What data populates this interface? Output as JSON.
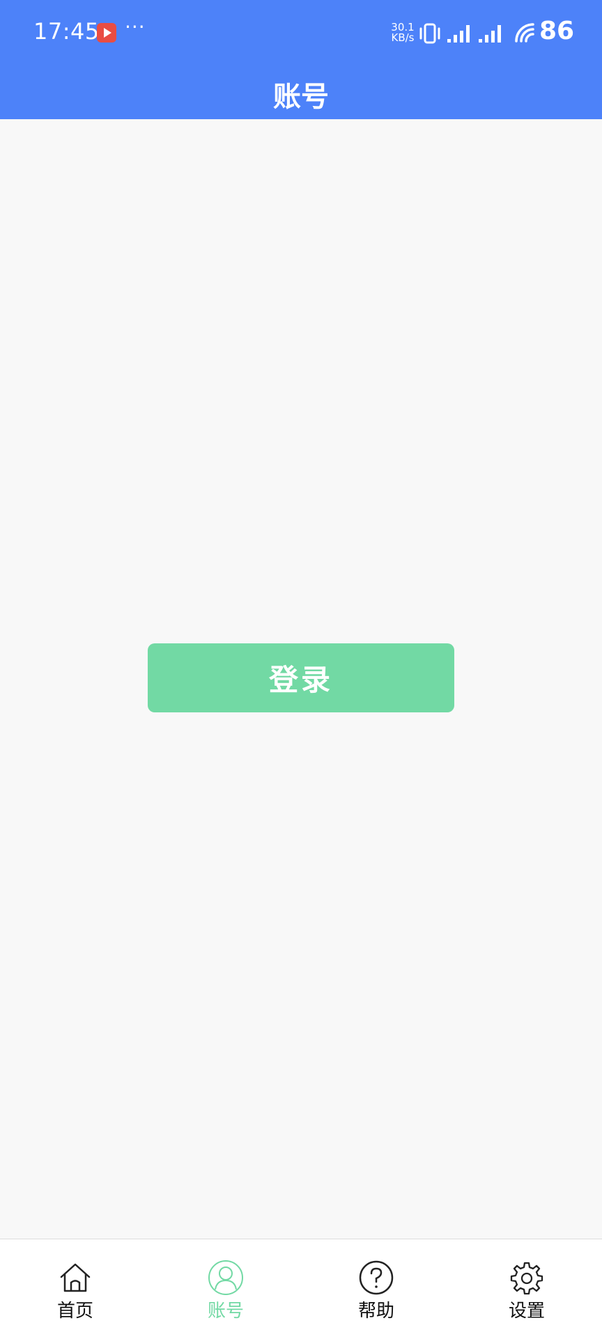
{
  "status_bar": {
    "time": "17:45",
    "more": "···",
    "net_speed_value": "30.1",
    "net_speed_unit": "KB/s",
    "battery": "86"
  },
  "header": {
    "title": "账号",
    "background_color": "#4d82f9"
  },
  "main": {
    "login_label": "登录",
    "login_color": "#72d9a4"
  },
  "bottom_nav": {
    "items": [
      {
        "label": "首页",
        "icon": "home-icon",
        "active": false
      },
      {
        "label": "账号",
        "icon": "user-icon",
        "active": true
      },
      {
        "label": "帮助",
        "icon": "help-icon",
        "active": false
      },
      {
        "label": "设置",
        "icon": "gear-icon",
        "active": false
      }
    ],
    "active_color": "#72d9a4"
  }
}
